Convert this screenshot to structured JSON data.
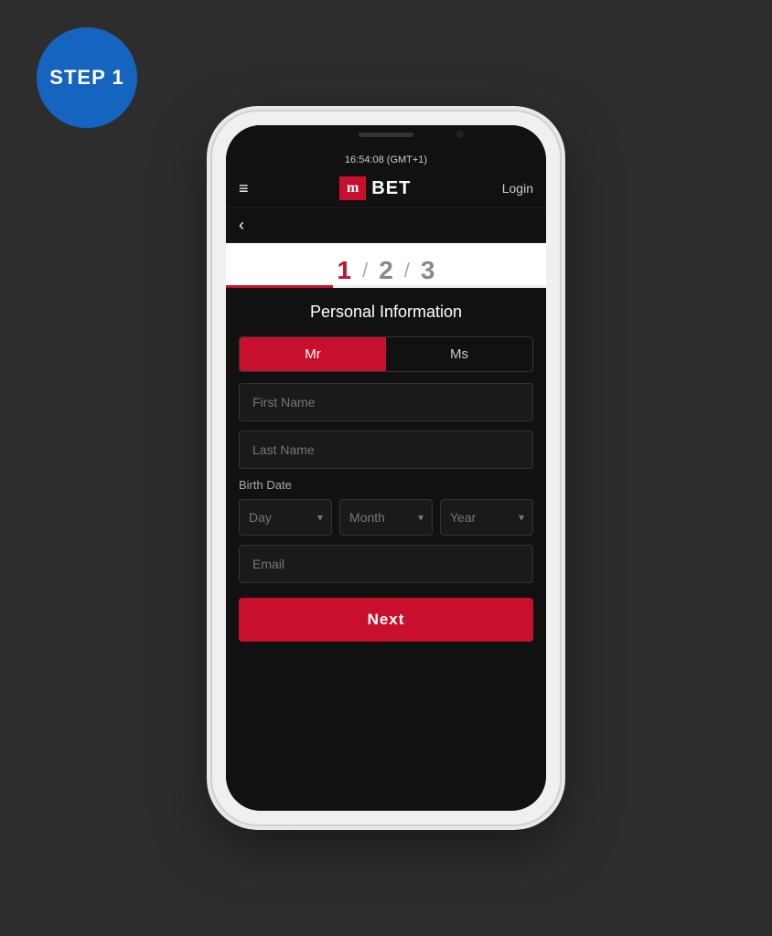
{
  "step_badge": {
    "line1": "STEP 1"
  },
  "status_bar": {
    "time": "16:54:08 (GMT+1)"
  },
  "header": {
    "menu_icon": "≡",
    "logo_m": "m",
    "logo_bet": "BET",
    "login_label": "Login"
  },
  "back": {
    "arrow": "‹"
  },
  "progress": {
    "step1": "1",
    "sep1": "/",
    "step2": "2",
    "sep2": "/",
    "step3": "3"
  },
  "form": {
    "title": "Personal Information",
    "gender_mr": "Mr",
    "gender_ms": "Ms",
    "first_name_placeholder": "First Name",
    "last_name_placeholder": "Last Name",
    "birth_date_label": "Birth Date",
    "day_placeholder": "Day",
    "month_placeholder": "Month",
    "year_placeholder": "Year",
    "email_placeholder": "Email",
    "next_label": "Next"
  }
}
